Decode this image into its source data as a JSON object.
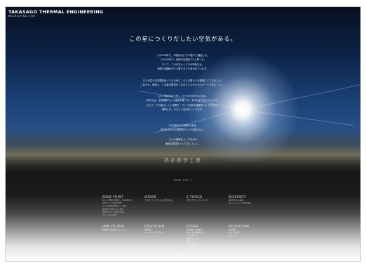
{
  "brand": {
    "name": "TAKASAGO THERMAL ENGINEERING",
    "subtitle": "RECRUITING SITE"
  },
  "hero": {
    "headline": "この星につくりだしたい空気がある。",
    "paragraphs": [
      [
        "この100年で、人間はおよそ70億人に増加した。",
        "この100年で、地球の気温は1℃上昇した。",
        "そして、このままいくと100年後には、",
        "地球の温暖は4℃上昇するとも言われています。"
      ],
      [
        "ひとが生きる空間を良くするために、ひとの暮らしを快適にしてきました。",
        "これから、地球と、この星の環境をこれまでになかったスピードで変えていく。"
      ],
      [
        "ひとが幸せなときも、ひとのかたわらにある。",
        "私たちは、空気調和という技術を使って、すべてを守るようにして。",
        "ひとが、その星らしくいる限り、そして空気の温度をつくりながら、",
        "地球にも、やさしい空気をつくりだす。"
      ],
      [
        "これが私たちの使命である。",
        "あなたのお力の限界を少しでも越えたい。"
      ],
      [
        "ひとの地球をつくりながら",
        "地球の環境をつくりだしていく。"
      ]
    ],
    "signature": "高砂熱学工業"
  },
  "page_top": "PAGE TOP ↑",
  "footer": {
    "row1": [
      {
        "title": "EDGE POINT",
        "items": [
          "私たちが目指す環境づくりを実現する",
          "空気をつくる仕事の領域",
          "ひとと空間の関係をつくり出す",
          "高砂熱学工業のひとの流れ",
          "地球にやさしい空気を未来へ",
          "わたしたちの技術"
        ]
      },
      {
        "title": "VISION",
        "items": [
          "この星につくりだしたい空気がある。"
        ]
      },
      {
        "title": "5 TOPICS",
        "items": [
          "空気とプロジェクトの一歩"
        ]
      },
      {
        "title": "DIVERSITY",
        "items": [
          "多様性のある未来へ",
          "ダイバーシティへの取り組み"
        ]
      }
    ],
    "row2": [
      {
        "title": "JOIN TO RUN",
        "items": [
          "高砂熱学工業で働くということ"
        ]
      },
      {
        "title": "EDUCATION",
        "items": [
          "研修制度",
          "キャリアアップサポート"
        ]
      },
      {
        "title": "OTHER",
        "items": [
          "会社概要・事業紹介",
          "数字で見る高砂熱学工業",
          "ワークスタイル",
          "福利厚生・制度",
          "採用データ",
          "よくある質問"
        ]
      },
      {
        "title": "RECRUITING",
        "items": [
          "新卒採用",
          "キャリア採用",
          "エントリー"
        ]
      }
    ]
  }
}
